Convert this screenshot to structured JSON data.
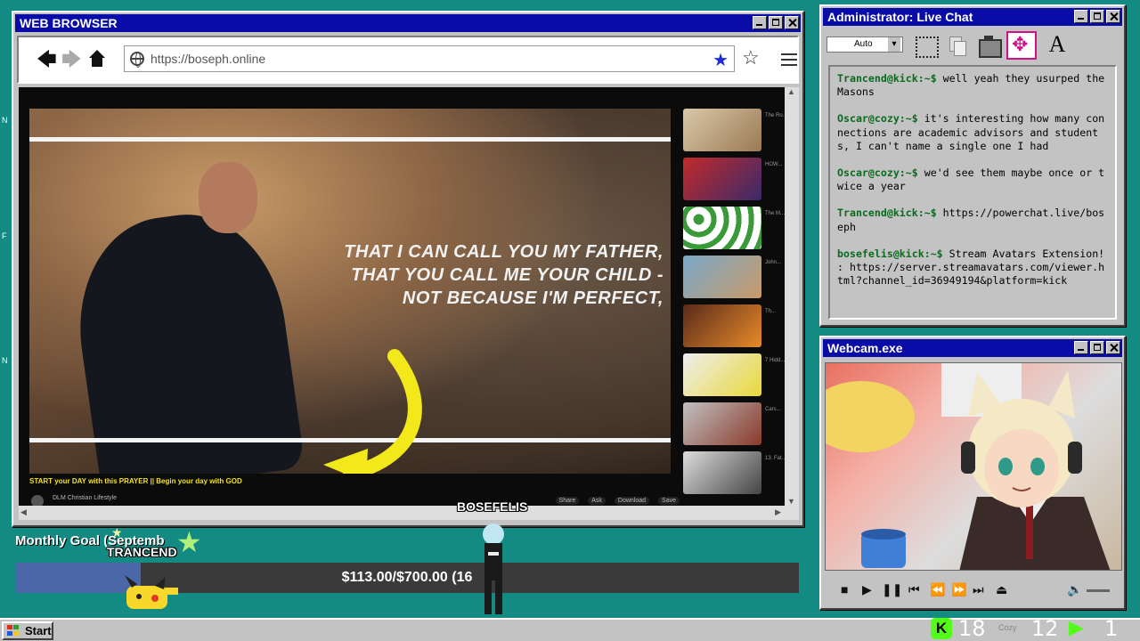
{
  "browser": {
    "title": "WEB BROWSER",
    "url": "https://boseph.online",
    "video": {
      "overlay_lines": [
        "THAT I CAN CALL YOU MY FATHER,",
        "THAT YOU CALL ME YOUR CHILD -",
        "NOT BECAUSE I'M PERFECT,"
      ],
      "caption": "START your DAY with this PRAYER || Begin your day with GOD",
      "channel": "DLM Christian Lifestyle",
      "actions": [
        "Share",
        "Ask",
        "Download",
        "Save"
      ]
    },
    "thumb_meta": [
      "The Ro...",
      "HOW...",
      "The M...",
      "John...",
      "Th...",
      "7 Hidd...",
      "Cars...",
      "13. Fat..."
    ]
  },
  "chat": {
    "title": "Administrator: Live Chat",
    "select_value": "Auto",
    "messages": [
      {
        "prompt": "Trancend@kick:~$",
        "text": " well yeah they usurped the Masons"
      },
      {
        "prompt": "Oscar@cozy:~$",
        "text": " it's interesting how many connections are academic advisors and students, I can't name a single one I had"
      },
      {
        "prompt": "Oscar@cozy:~$",
        "text": " we'd see them maybe once or twice a year"
      },
      {
        "prompt": "Trancend@kick:~$",
        "text": " https://powerchat.live/boseph"
      },
      {
        "prompt": "bosefelis@kick:~$",
        "text": " Stream Avatars Extension! : https://server.streamavatars.com/viewer.html?channel_id=36949194&platform=kick"
      }
    ]
  },
  "webcam": {
    "title": "Webcam.exe"
  },
  "goal": {
    "label": "Monthly Goal (Septemb",
    "text": "$113.00/$700.00 (16",
    "progress": 0.16
  },
  "avatars": {
    "trancend": "TRANCEND",
    "bosefelis": "BOSEFELIS"
  },
  "taskbar": {
    "start_label": "Start",
    "k_label": "K",
    "kick_count": "18",
    "cozy_label": "Cozy",
    "cozy_count": "12",
    "other_count": "1"
  },
  "colors": {
    "desktop": "#138a82",
    "titlebar": "#0a0ca8",
    "prompt": "#0a6a1e",
    "kick_green": "#53fc18",
    "arrow_yellow": "#f3e81a"
  }
}
